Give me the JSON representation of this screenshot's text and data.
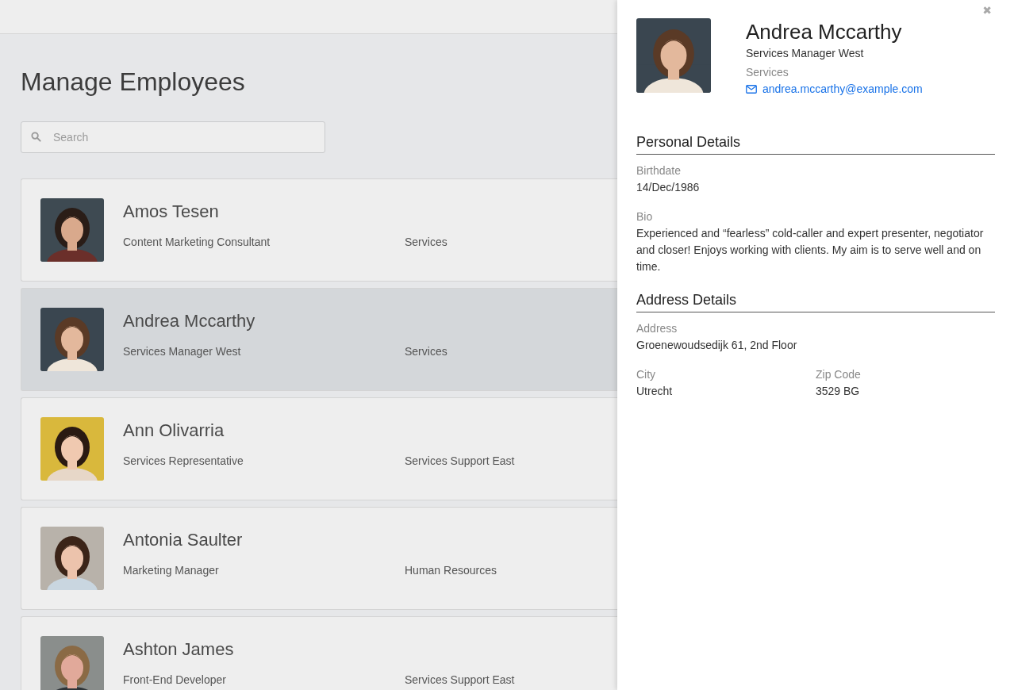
{
  "page": {
    "title": "Manage Employees"
  },
  "search": {
    "placeholder": "Search"
  },
  "employees": [
    {
      "name": "Amos Tesen",
      "role": "Content Marketing Consultant",
      "department": "Services",
      "selected": false
    },
    {
      "name": "Andrea Mccarthy",
      "role": "Services Manager West",
      "department": "Services",
      "selected": true
    },
    {
      "name": "Ann Olivarria",
      "role": "Services Representative",
      "department": "Services Support East",
      "selected": false
    },
    {
      "name": "Antonia Saulter",
      "role": "Marketing Manager",
      "department": "Human Resources",
      "selected": false
    },
    {
      "name": "Ashton James",
      "role": "Front-End Developer",
      "department": "Services Support East",
      "selected": false
    }
  ],
  "details": {
    "close": "✖",
    "name": "Andrea Mccarthy",
    "title": "Services Manager West",
    "department": "Services",
    "email": "andrea.mccarthy@example.com",
    "sections": [
      {
        "heading": "Personal Details",
        "rows": [
          [
            {
              "label": "Birthdate",
              "value": "14/Dec/1986"
            }
          ],
          [
            {
              "label": "Bio",
              "value": "Experienced and “fearless” cold-caller and expert presenter, negotiator and closer! Enjoys working with clients. My aim is to serve well and on time."
            }
          ]
        ]
      },
      {
        "heading": "Address Details",
        "rows": [
          [
            {
              "label": "Address",
              "value": "Groenewoudsedijk 61, 2nd Floor"
            }
          ],
          [
            {
              "label": "City",
              "value": "Utrecht"
            },
            {
              "label": "Zip Code",
              "value": "3529 BG"
            }
          ]
        ]
      }
    ]
  }
}
